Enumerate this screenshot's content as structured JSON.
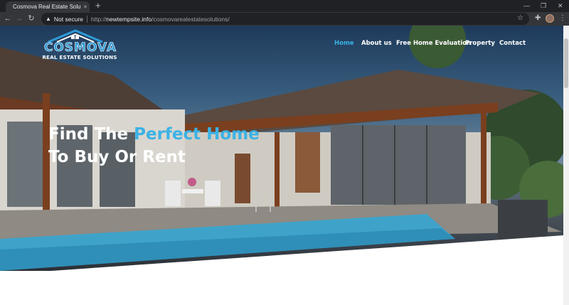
{
  "browser": {
    "tab_title": "Cosmova Real Estate Solutions",
    "tab_close": "×",
    "new_tab": "+",
    "window_controls": [
      "—",
      "❐",
      "✕"
    ],
    "security_label": "Not secure",
    "url_scheme": "http://",
    "url_host": "newtempsite.info",
    "url_path": "/cosmovarealestatesolutions/"
  },
  "site": {
    "logo": {
      "word": "COSMOVA",
      "sub": "REAL ESTATE SOLUTIONS"
    },
    "nav": [
      {
        "label": "Home",
        "active": true
      },
      {
        "label": "About us",
        "active": false
      },
      {
        "label": "Free Home Evaluation",
        "active": false
      },
      {
        "label": "Property",
        "active": false
      },
      {
        "label": "Contact",
        "active": false
      }
    ],
    "hero": {
      "line1_prefix": "Find The ",
      "line1_accent": "Perfect Home",
      "line2": "To Buy Or Rent"
    }
  },
  "colors": {
    "accent": "#3bb2e6",
    "brand": "#2d9bd6"
  },
  "icons": [
    "back-arrow-icon",
    "forward-arrow-icon",
    "reload-icon",
    "warning-icon",
    "star-icon",
    "extensions-icon",
    "profile-avatar",
    "menu-kebab-icon"
  ]
}
